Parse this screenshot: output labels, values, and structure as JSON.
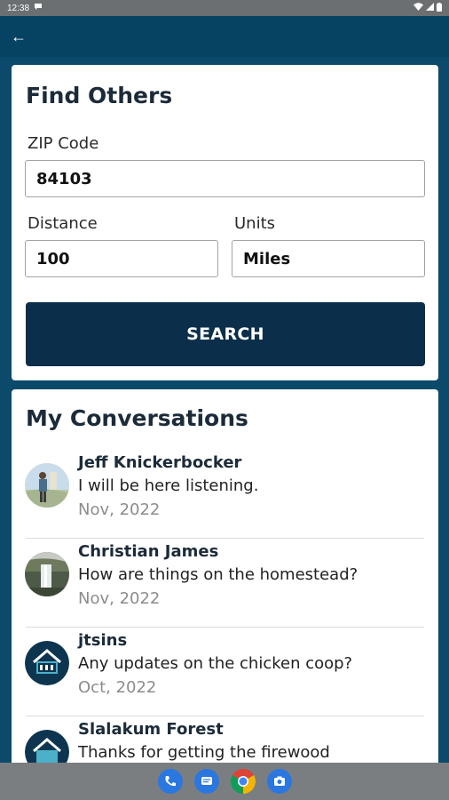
{
  "status_bar": {
    "time": "12:38",
    "notification_icon": "chat-bubble-icon",
    "icons": [
      "wifi-icon",
      "signal-icon",
      "battery-icon"
    ]
  },
  "app_bar": {
    "back_icon": "arrow-left-icon",
    "back_glyph": "←"
  },
  "find_others": {
    "title": "Find Others",
    "zip_label": "ZIP Code",
    "zip_value": "84103",
    "distance_label": "Distance",
    "distance_value": "100",
    "units_label": "Units",
    "units_value": "Miles",
    "search_label": "SEARCH"
  },
  "conversations": {
    "title": "My Conversations",
    "items": [
      {
        "name": "Jeff Knickerbocker",
        "message": "I will be here listening.",
        "date": "Nov, 2022",
        "avatar": "photo-person-avatar"
      },
      {
        "name": "Christian James",
        "message": "How are things on the homestead?",
        "date": "Nov, 2022",
        "avatar": "photo-waterfall-avatar"
      },
      {
        "name": "jtsins",
        "message": "Any updates on the chicken coop?",
        "date": "Oct, 2022",
        "avatar": "p2s-logo-avatar"
      },
      {
        "name": "Slalakum Forest",
        "message": "Thanks for getting the firewood",
        "date": "",
        "avatar": "p2s-logo-avatar"
      }
    ]
  },
  "nav_bar": {
    "apps": [
      "phone-icon",
      "messages-icon",
      "chrome-icon",
      "camera-icon"
    ]
  },
  "colors": {
    "background": "#0b4a6a",
    "button": "#0b2f4b",
    "title": "#1c2b3a",
    "date": "#8c8c8c"
  }
}
